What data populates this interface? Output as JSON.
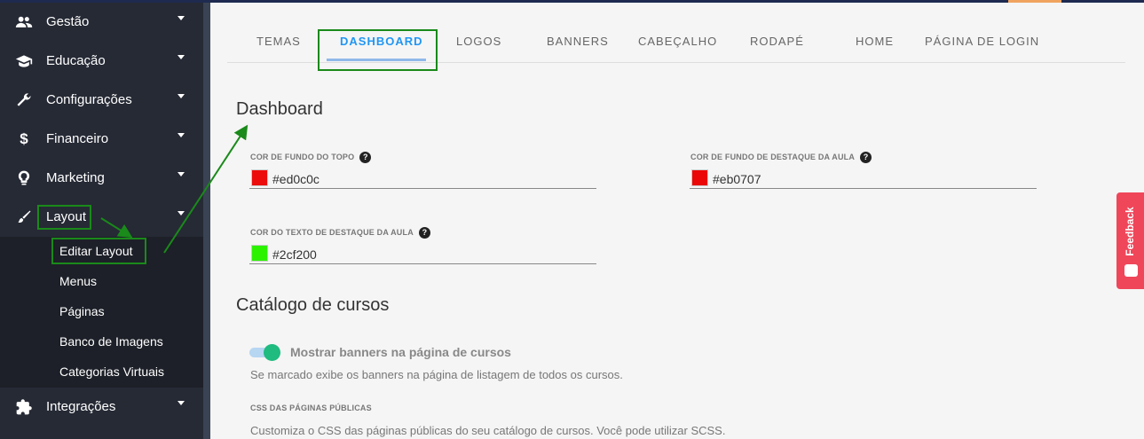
{
  "sidebar": {
    "items": [
      {
        "label": "Gestão",
        "icon": "people-icon"
      },
      {
        "label": "Educação",
        "icon": "graduation-cap-icon"
      },
      {
        "label": "Configurações",
        "icon": "wrench-icon"
      },
      {
        "label": "Financeiro",
        "icon": "dollar-icon"
      },
      {
        "label": "Marketing",
        "icon": "lightbulb-icon"
      },
      {
        "label": "Layout",
        "icon": "brush-icon"
      },
      {
        "label": "Integrações",
        "icon": "puzzle-icon"
      }
    ],
    "layout_subitems": [
      "Editar Layout",
      "Menus",
      "Páginas",
      "Banco de Imagens",
      "Categorias Virtuais"
    ]
  },
  "tabs": [
    "TEMAS",
    "DASHBOARD",
    "LOGOS",
    "BANNERS",
    "CABEÇALHO",
    "RODAPÉ",
    "HOME",
    "PÁGINA DE LOGIN"
  ],
  "active_tab": "DASHBOARD",
  "dashboard": {
    "title": "Dashboard",
    "fields": [
      {
        "label": "COR DE FUNDO DO TOPO",
        "value": "#ed0c0c",
        "color": "#ed0c0c"
      },
      {
        "label": "COR DE FUNDO DE DESTAQUE DA AULA",
        "value": "#eb0707",
        "color": "#eb0707"
      },
      {
        "label": "COR DO TEXTO DE DESTAQUE DA AULA",
        "value": "#2cf200",
        "color": "#2cf200"
      }
    ],
    "help_glyph": "?"
  },
  "catalog": {
    "title": "Catálogo de cursos",
    "toggle_label": "Mostrar banners na página de cursos",
    "toggle_on": true,
    "toggle_help": "Se marcado exibe os banners na página de listagem de todos os cursos.",
    "css_label": "CSS DAS PÁGINAS PÚBLICAS",
    "css_help": "Customiza o CSS das páginas públicas do seu catálogo de cursos. Você pode utilizar SCSS."
  },
  "feedback": {
    "label": "Feedback"
  },
  "colors": {
    "sidebar": "#262a35",
    "annotation": "#1a8a1a",
    "active_tab": "#2196f3",
    "toggle": "#1fbb7f",
    "feedback": "#f0465a"
  }
}
